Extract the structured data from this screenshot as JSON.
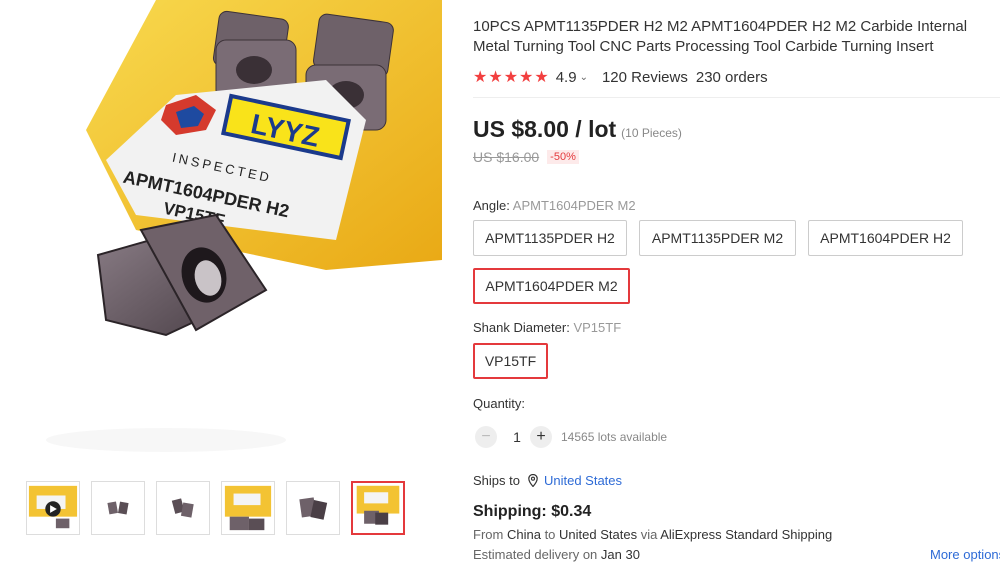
{
  "product": {
    "title": "10PCS APMT1135PDER H2 M2 APMT1604PDER H2 M2 Carbide Internal Metal Turning Tool CNC Parts Processing Tool Carbide Turning Insert",
    "image_text": {
      "brand": "LYYZ",
      "inspected": "INSPECTED",
      "model_line1": "APMT1604PDER H2",
      "model_line2": "VP15TF"
    }
  },
  "rating": {
    "stars": "★★★★★",
    "value": "4.9",
    "reviews": "120 Reviews",
    "orders": "230 orders"
  },
  "price": {
    "current": "US $8.00 / lot",
    "pieces": "(10 Pieces)",
    "original": "US $16.00",
    "discount": "-50%"
  },
  "angle": {
    "label": "Angle:",
    "selected": "APMT1604PDER M2",
    "options": [
      "APMT1135PDER H2",
      "APMT1135PDER M2",
      "APMT1604PDER H2",
      "APMT1604PDER M2"
    ]
  },
  "shank": {
    "label": "Shank Diameter:",
    "selected": "VP15TF",
    "options": [
      "VP15TF"
    ]
  },
  "quantity": {
    "label": "Quantity:",
    "minus": "−",
    "plus": "+",
    "value": "1",
    "available": "14565 lots available"
  },
  "shipping": {
    "ships_to_label": "Ships to",
    "country": "United States",
    "price": "Shipping: $0.34",
    "from_prefix": "From",
    "from": "China",
    "to_prefix": "to",
    "to": "United States",
    "via_prefix": "via",
    "method": "AliExpress Standard Shipping",
    "delivery_prefix": "Estimated delivery on",
    "delivery_date": "Jan 30",
    "more_options": "More options"
  },
  "colors": {
    "accent_red": "#e4393c",
    "star_red": "#f23f3f",
    "link_blue": "#2e6bd6",
    "insert_case_yellow": "#f5c229"
  },
  "icons": {
    "location": "location-pin-icon",
    "caret": "caret-down-icon"
  }
}
